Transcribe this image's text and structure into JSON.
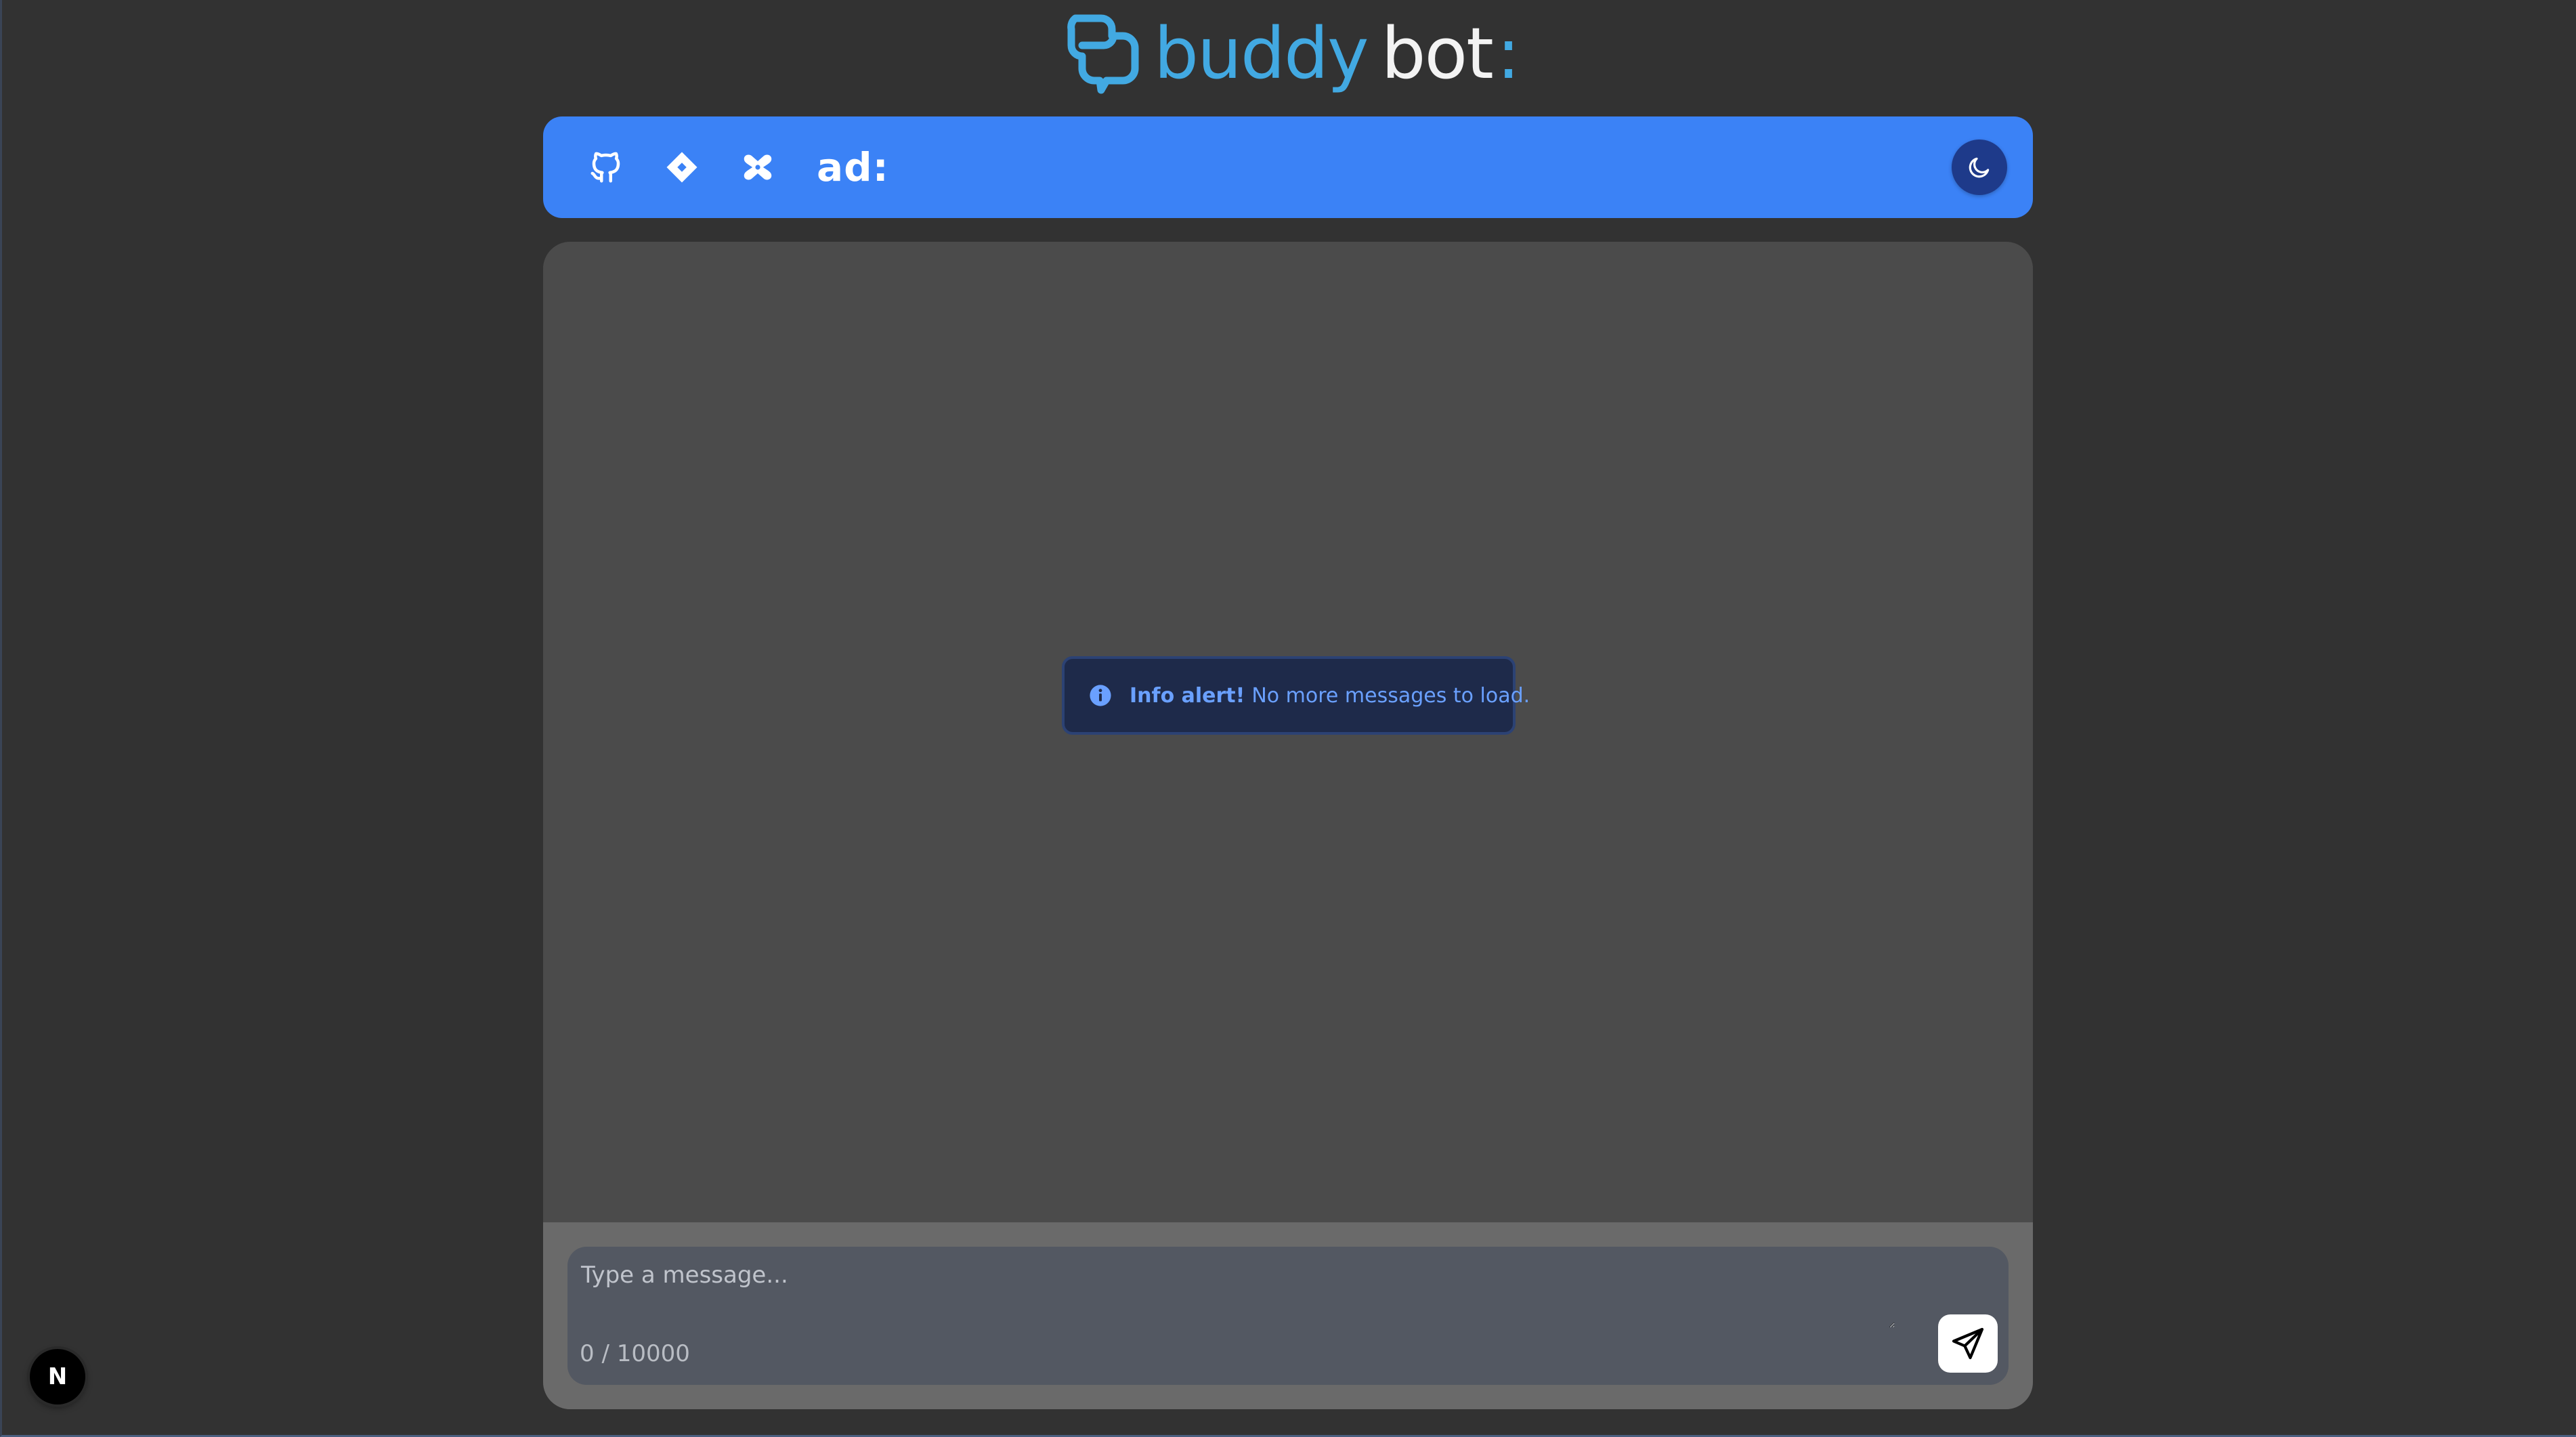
{
  "brand": {
    "word_primary": "buddy",
    "word_secondary": "bot",
    "word_suffix": ":",
    "color_primary": "#42a9e2",
    "color_secondary": "#f3f3f3",
    "icon": "speech-bubbles-logo-icon"
  },
  "navbar": {
    "background": "#3b82f6",
    "links": [
      {
        "icon": "github-icon"
      },
      {
        "icon": "jira-icon"
      },
      {
        "icon": "confluence-icon"
      }
    ],
    "ad_label": "ad:",
    "theme_toggle": {
      "icon": "moon-icon",
      "color": "#1e3a8a"
    }
  },
  "chat": {
    "alert": {
      "title": "Info alert!",
      "message": "No more messages to load.",
      "icon": "info-icon",
      "color": "#6aa0ff"
    }
  },
  "composer": {
    "placeholder": "Type a message...",
    "value": "",
    "char_count": "0 / 10000",
    "send_icon": "send-icon"
  },
  "dev_badge": {
    "label": "N",
    "icon": "nextjs-icon"
  }
}
